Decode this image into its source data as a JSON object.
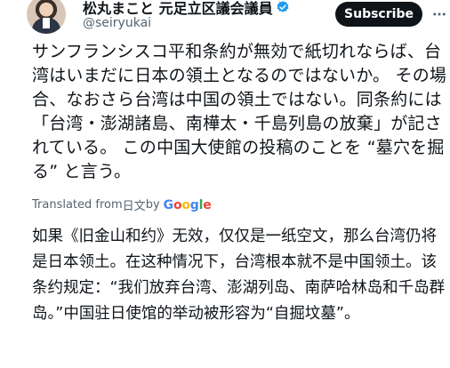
{
  "author": {
    "name": "松丸まこと 元足立区議会議員",
    "handle": "@seiryukai",
    "verified_icon": "verified-badge-icon",
    "accent": "#1d9bf0"
  },
  "actions": {
    "subscribe_label": "Subscribe",
    "more_icon": "more-options-icon"
  },
  "tweet": {
    "original_text": "サンフランシスコ平和条約が無効で紙切れならば、台湾はいまだに日本の領土となるのではないか。 その場合、なおさら台湾は中国の領土ではない。同条約には「台湾・澎湖諸島、南樺太・千島列島の放棄」が記されている。 この中国大使館の投稿のことを “墓穴を掘る” と言う。",
    "translated_prefix": "Translated from ",
    "translated_lang": "日文",
    "translated_by": " by ",
    "translation_text": "如果《旧金山和约》无效，仅仅是一纸空文，那么台湾仍将是日本领土。在这种情况下，台湾根本就不是中国领土。该条约规定：“我们放弃台湾、澎湖列岛、南萨哈林岛和千岛群岛。”中国驻日使馆的举动被形容为“自掘坟墓”。"
  }
}
